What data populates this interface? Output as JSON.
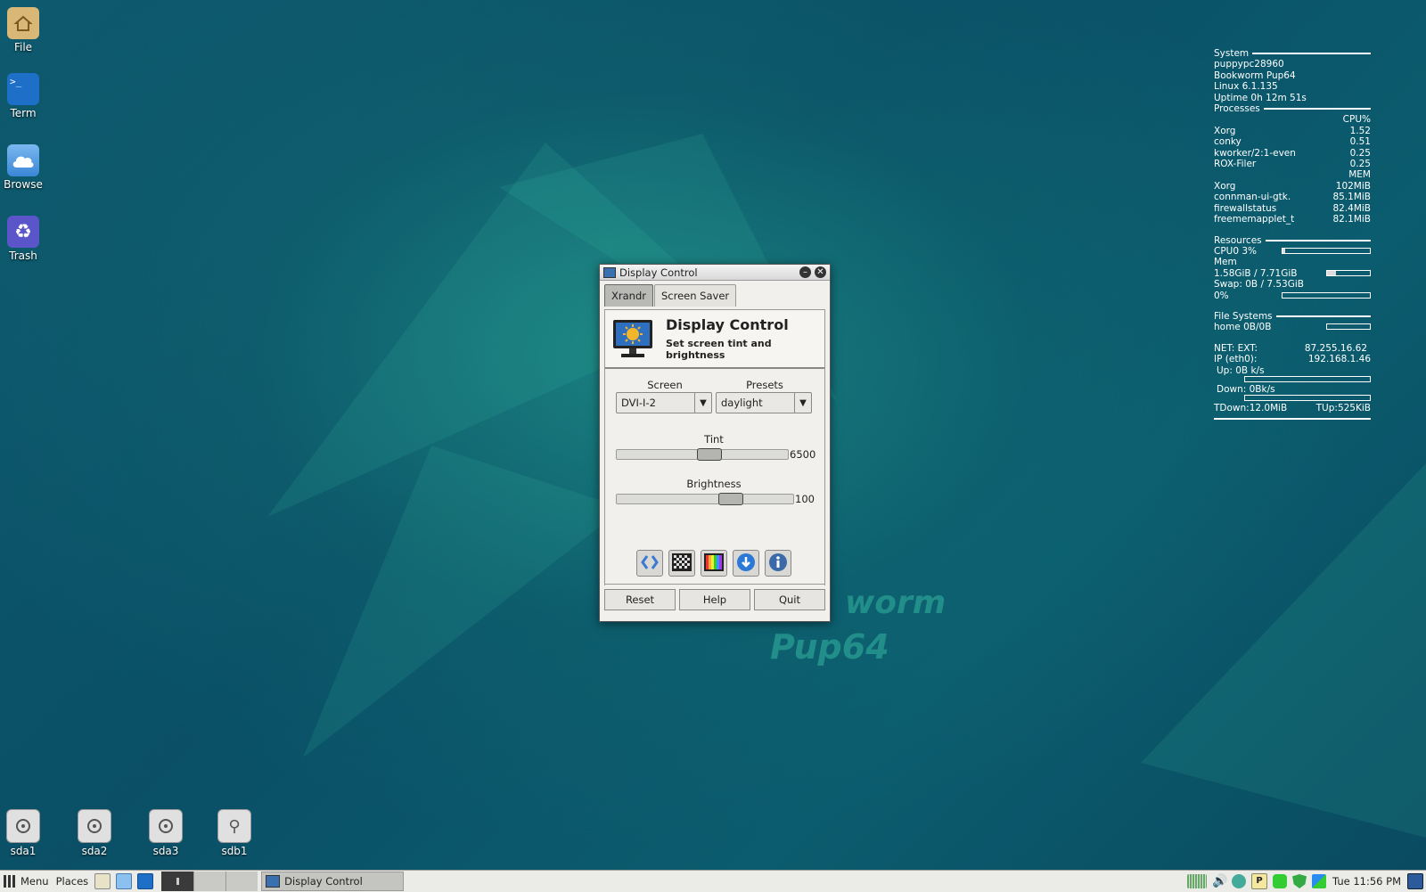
{
  "desktop": {
    "icons": [
      {
        "label": "File",
        "icon": "home-folder-icon"
      },
      {
        "label": "Term",
        "icon": "terminal-icon"
      },
      {
        "label": "Browse",
        "icon": "cloud-icon"
      },
      {
        "label": "Trash",
        "icon": "recycle-icon"
      }
    ],
    "drives": [
      {
        "label": "sda1"
      },
      {
        "label": "sda2"
      },
      {
        "label": "sda3"
      },
      {
        "label": "sdb1"
      }
    ],
    "wallpaper_text": [
      "worm",
      "Pup64"
    ]
  },
  "conky": {
    "system_title": "System",
    "hostname": "puppypc28960",
    "distro": "Bookworm Pup64",
    "kernel": "Linux 6.1.135",
    "uptime": "Uptime 0h 12m 51s",
    "processes_title": "Processes",
    "cpu_header": "CPU%",
    "cpu_procs": [
      {
        "name": "Xorg",
        "value": "1.52"
      },
      {
        "name": "conky",
        "value": "0.51"
      },
      {
        "name": "kworker/2:1-even",
        "value": "0.25"
      },
      {
        "name": "ROX-Filer",
        "value": "0.25"
      }
    ],
    "mem_header": "MEM",
    "mem_procs": [
      {
        "name": "Xorg",
        "value": "102MiB"
      },
      {
        "name": "connman-ui-gtk.",
        "value": "85.1MiB"
      },
      {
        "name": "firewallstatus",
        "value": "82.4MiB"
      },
      {
        "name": "freememapplet_t",
        "value": "82.1MiB"
      }
    ],
    "resources_title": "Resources",
    "cpu0": "CPU0 3%",
    "cpu0_level": 0.03,
    "mem_label": "Mem",
    "mem_usage": "1.58GiB / 7.71GiB",
    "mem_level": 0.2,
    "swap": "Swap: 0B / 7.53GiB",
    "swap_pct": "0%",
    "swap_level": 0,
    "fs_title": "File Systems",
    "home_fs": "home 0B/0B",
    "net_ext_label": "NET: EXT:",
    "net_ext_ip": "87.255.16.62",
    "ip_label": "IP (eth0):",
    "ip": "192.168.1.46",
    "up": "Up: 0B k/s",
    "down": "Down: 0Bk/s",
    "tdown": "TDown:12.0MiB",
    "tup": "TUp:525KiB"
  },
  "window": {
    "title": "Display Control",
    "tabs": [
      {
        "label": "Xrandr",
        "active": true
      },
      {
        "label": "Screen Saver",
        "active": false
      }
    ],
    "header_title": "Display Control",
    "header_subtitle": "Set screen tint and brightness",
    "screen_label": "Screen",
    "screen_value": "DVI-I-2",
    "presets_label": "Presets",
    "presets_value": "daylight",
    "tint_label": "Tint",
    "tint_value": "6500",
    "tint_level": 0.55,
    "brightness_label": "Brightness",
    "brightness_value": "100",
    "brightness_level": 0.67,
    "icon_buttons": [
      "arrows-icon",
      "checker-pattern-icon",
      "color-bars-icon",
      "download-icon",
      "info-icon"
    ],
    "buttons": {
      "reset": "Reset",
      "help": "Help",
      "quit": "Quit"
    }
  },
  "taskbar": {
    "menu": "Menu",
    "places": "Places",
    "task": "Display Control",
    "clock": "Tue 11:56 PM"
  }
}
